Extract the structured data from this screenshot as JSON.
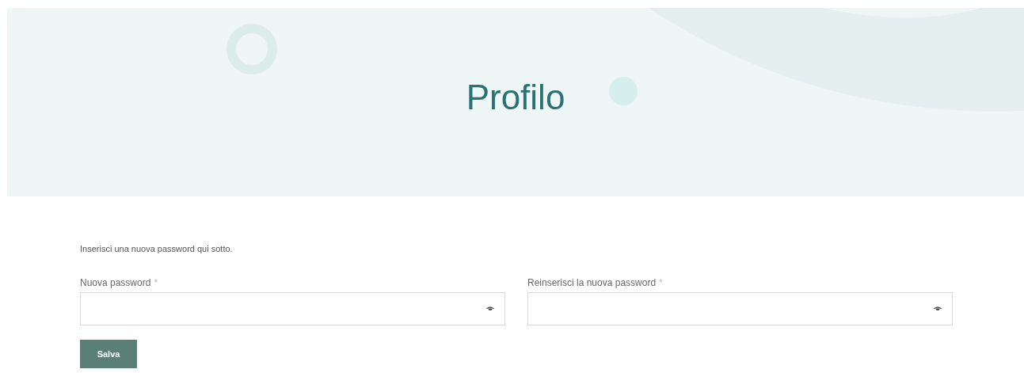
{
  "banner": {
    "title": "Profilo"
  },
  "form": {
    "intro": "Inserisci una nuova password qui sotto.",
    "fields": [
      {
        "label": "Nuova password",
        "required_mark": "*"
      },
      {
        "label": "Reinserisci la nuova password",
        "required_mark": "*"
      }
    ],
    "submit": "Salva"
  }
}
